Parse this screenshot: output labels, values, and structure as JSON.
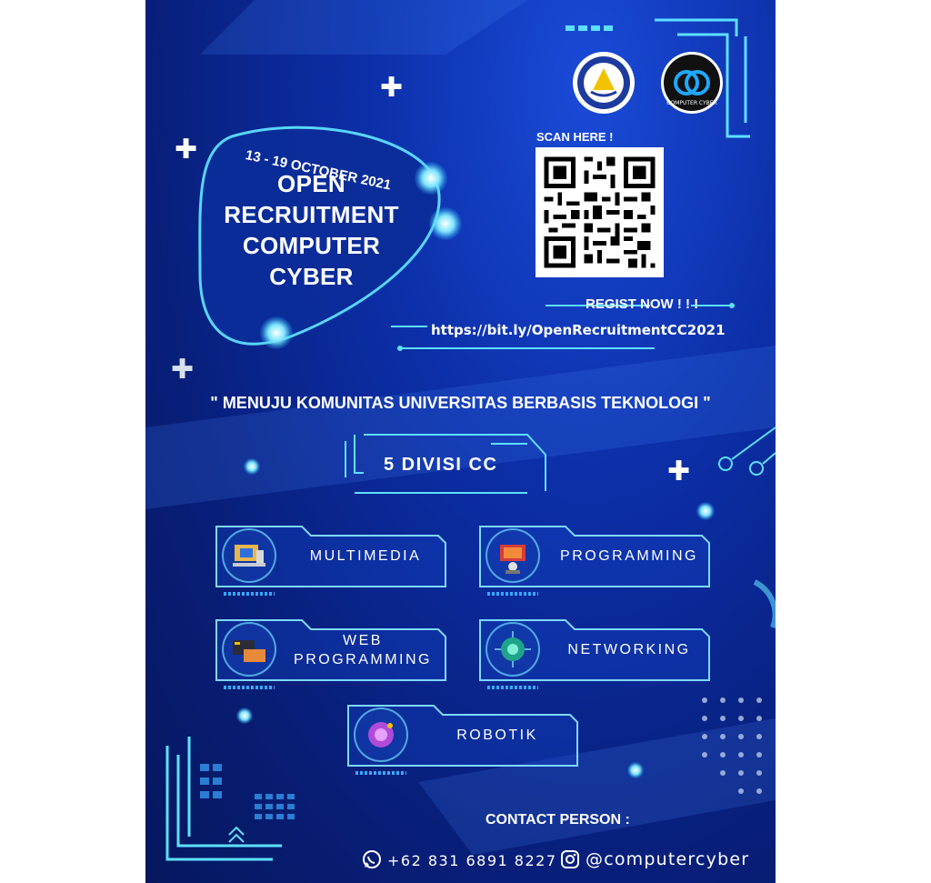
{
  "event": {
    "date": "13 - 19 OCTOBER 2021",
    "title_lines": [
      "OPEN",
      "RECRUITMENT",
      "COMPUTER",
      "CYBER"
    ]
  },
  "logos": {
    "left": "university-seal",
    "right": "computer-cyber-logo",
    "right_text": "COMPUTER CYBER"
  },
  "registration": {
    "scan_label": "SCAN HERE !",
    "regist_label": "REGIST NOW ! ! !",
    "url": "https://bit.ly/OpenRecruitmentCC2021"
  },
  "tagline": "\" MENUJU KOMUNITAS UNIVERSITAS BERBASIS TEKNOLOGI \"",
  "divisions": {
    "title": "5 DIVISI CC",
    "items": [
      {
        "label": "MULTIMEDIA",
        "icon": "multimedia-icon"
      },
      {
        "label": "PROGRAMMING",
        "icon": "programming-icon"
      },
      {
        "label": "WEB\nPROGRAMMING",
        "line1": "WEB",
        "line2": "PROGRAMMING",
        "icon": "web-programming-icon"
      },
      {
        "label": "NETWORKING",
        "icon": "networking-icon"
      },
      {
        "label": "ROBOTIK",
        "icon": "robotik-icon"
      }
    ]
  },
  "contact": {
    "label": "CONTACT PERSON :",
    "phone": "+62 831 6891 8227",
    "instagram": "@computercyber"
  },
  "colors": {
    "background": "#0c2fa8",
    "accent": "#5ee0ff",
    "text": "#ffffff"
  }
}
